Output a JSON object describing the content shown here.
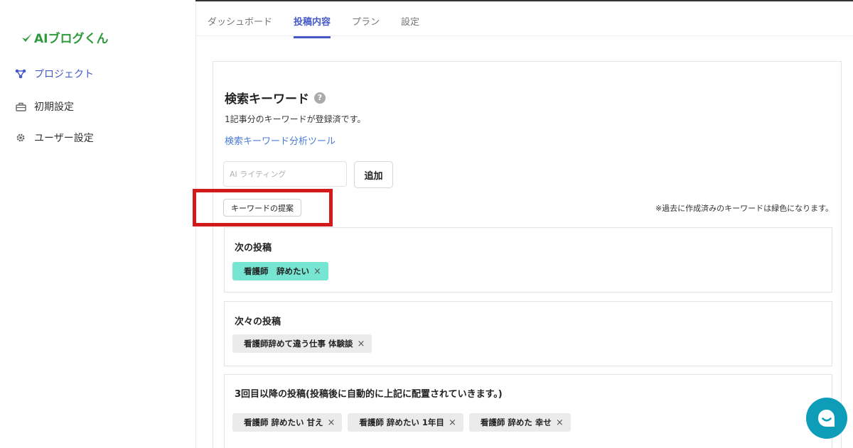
{
  "brand": {
    "logo_text": "AIブログくん",
    "accent": "#2f9a3c"
  },
  "sidebar": {
    "items": [
      {
        "label": "プロジェクト",
        "icon": "project-icon",
        "active": true
      },
      {
        "label": "初期設定",
        "icon": "toolbox-icon",
        "active": false
      },
      {
        "label": "ユーザー設定",
        "icon": "gear-icon",
        "active": false
      }
    ]
  },
  "tabs": [
    {
      "label": "ダッシュボード",
      "active": false
    },
    {
      "label": "投稿内容",
      "active": true
    },
    {
      "label": "プラン",
      "active": false
    },
    {
      "label": "設定",
      "active": false
    }
  ],
  "keywords": {
    "title": "検索キーワード",
    "help": "?",
    "count_text": "1記事分のキーワードが登録済です。",
    "tool_link": "検索キーワード分析ツール",
    "input_placeholder": "AI ライティング",
    "add_label": "追加",
    "suggest_label": "キーワードの提案",
    "note": "※過去に作成済みのキーワードは緑色になります。"
  },
  "groups": [
    {
      "title": "次の投稿",
      "chips": [
        {
          "label": "看護師　辞めたい",
          "highlight": true
        }
      ]
    },
    {
      "title": "次々の投稿",
      "chips": [
        {
          "label": "看護師辞めて違う仕事 体験談",
          "highlight": false
        }
      ]
    },
    {
      "title": "3回目以降の投稿(投稿後に自動的に上記に配置されていきます。)",
      "chips": [
        {
          "label": "看護師 辞めたい 甘え",
          "highlight": false
        },
        {
          "label": "看護師 辞めたい 1年目",
          "highlight": false
        },
        {
          "label": "看護師 辞めた 幸せ",
          "highlight": false
        }
      ]
    }
  ],
  "chip_remove_glyph": "×",
  "colors": {
    "primary": "#4659c9",
    "link": "#4b7bd4",
    "teal_chip": "#76e6d2",
    "chat": "#0e9db8",
    "highlight_box": "#d21a1a"
  }
}
